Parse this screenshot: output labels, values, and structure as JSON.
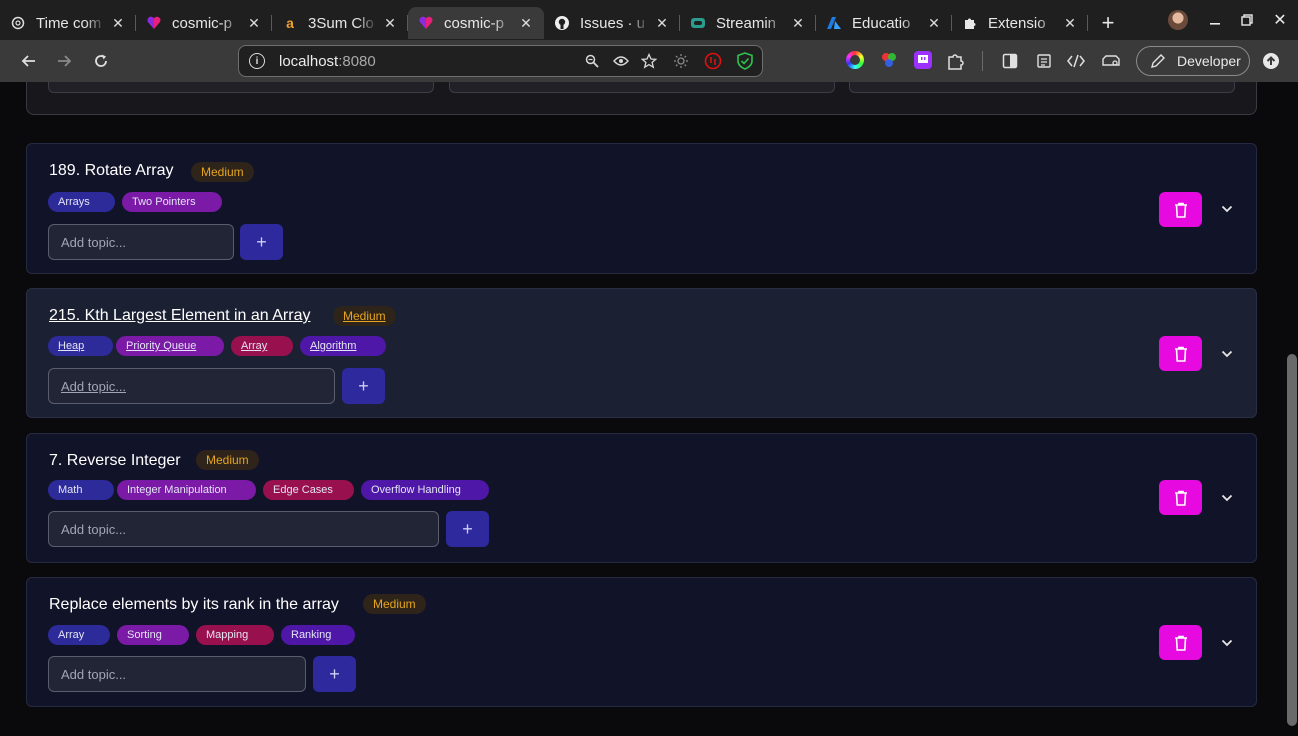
{
  "browser": {
    "tabs": [
      {
        "title": "Time com",
        "favicon": "openai-icon"
      },
      {
        "title": "cosmic-p",
        "favicon": "cosmic-icon"
      },
      {
        "title": "3Sum Clo",
        "favicon": "amazon-icon"
      },
      {
        "title": "cosmic-p",
        "favicon": "cosmic-icon",
        "active": true
      },
      {
        "title": "Issues · u",
        "favicon": "github-icon"
      },
      {
        "title": "Streamin",
        "favicon": "stream-icon"
      },
      {
        "title": "Educatio",
        "favicon": "azure-icon"
      },
      {
        "title": "Extensio",
        "favicon": "puzzle-icon"
      }
    ],
    "url_host": "localhost",
    "url_port": ":8080",
    "profile_label": "Developer"
  },
  "questions": [
    {
      "title": "189. Rotate Array",
      "difficulty": "Medium",
      "tags": [
        "Arrays",
        "Two Pointers"
      ],
      "topic_placeholder": "Add topic..."
    },
    {
      "title": "215. Kth Largest Element in an Array",
      "difficulty": "Medium",
      "tags": [
        "Heap",
        "Priority Queue",
        "Array",
        "Algorithm"
      ],
      "topic_placeholder": "Add topic..."
    },
    {
      "title": "7. Reverse Integer",
      "difficulty": "Medium",
      "tags": [
        "Math",
        "Integer Manipulation",
        "Edge Cases",
        "Overflow Handling"
      ],
      "topic_placeholder": "Add topic..."
    },
    {
      "title": "Replace elements by its rank in the array",
      "difficulty": "Medium",
      "tags": [
        "Array",
        "Sorting",
        "Mapping",
        "Ranking"
      ],
      "topic_placeholder": "Add topic..."
    }
  ],
  "colors": {
    "delete": "#e60ae0",
    "add": "#2e2a9e",
    "difficulty_medium": "#e6a423"
  }
}
